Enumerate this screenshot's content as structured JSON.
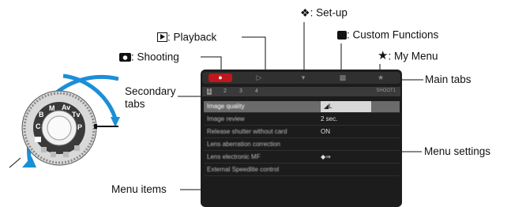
{
  "labels": {
    "playback": ": Playback",
    "setup": ": Set-up",
    "custom": ": Custom Functions",
    "mymenu": ": My Menu",
    "shooting": ": Shooting",
    "main_tabs": "Main tabs",
    "secondary_tabs": [
      "Secondary",
      "tabs"
    ],
    "menu_settings": "Menu settings",
    "menu_items": "Menu items"
  },
  "dial": {
    "marks": [
      "M",
      "Av",
      "Tv",
      "P",
      "B",
      "C"
    ]
  },
  "screen": {
    "main_tab_icons": [
      "camera",
      "play",
      "wrench",
      "custom",
      "star"
    ],
    "secondary_tabs": [
      "1",
      "2",
      "3",
      "4"
    ],
    "secondary_right": "SHOOT1",
    "items": [
      {
        "name": "Image quality",
        "value": "◢L"
      },
      {
        "name": "Image review",
        "value": "2 sec."
      },
      {
        "name": "Release shutter without card",
        "value": "ON"
      },
      {
        "name": "Lens aberration correction",
        "value": ""
      },
      {
        "name": "Lens electronic MF",
        "value": "◆⇒"
      },
      {
        "name": "External Speedlite control",
        "value": ""
      }
    ]
  },
  "colors": {
    "arrow_blue": "#1a8fd8",
    "active_tab": "#c0171c",
    "screen_bg": "#1c1c1c"
  }
}
